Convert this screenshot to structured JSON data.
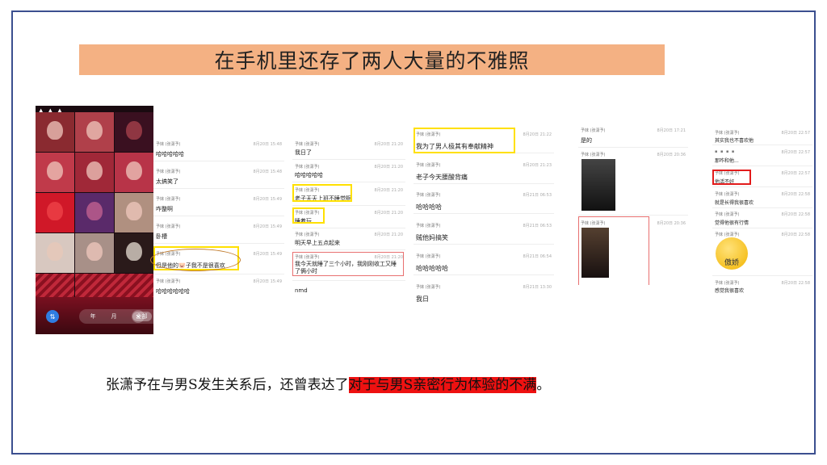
{
  "title": "在手机里还存了两人大量的不雅照",
  "caption": {
    "prefix": "张潇予在与男S发生关系后，还曾表达了",
    "highlight": "对于与男S亲密行为体验的不满",
    "suffix": "。"
  },
  "photo_grid": {
    "tabs": [
      "年",
      "月",
      "全部"
    ],
    "selected_tab": "全部",
    "left_icon": "sort-icon",
    "right_icon": "close-icon"
  },
  "panel1": {
    "messages": [
      {
        "sender": "予妹 (张潇予)",
        "time": "8月20日 15:48",
        "text": "哈哈哈哈哈"
      },
      {
        "sender": "予妹 (张潇予)",
        "time": "8月20日 15:48",
        "text": "太搞笑了"
      },
      {
        "sender": "予妹 (张潇予)",
        "time": "8月20日 15:49",
        "text": "咋整啊"
      },
      {
        "sender": "予妹 (张潇予)",
        "time": "8月20日 15:49",
        "text": "卧槽"
      },
      {
        "sender": "予妹 (张潇予)",
        "time": "8月20日 15:49",
        "text": "但是他的🐷子我不是很喜欢"
      },
      {
        "sender": "予妹 (张潇予)",
        "time": "8月20日 15:49",
        "text": "哈哈哈哈哈哈"
      }
    ]
  },
  "panel2": {
    "messages": [
      {
        "sender": "予妹 (张潇予)",
        "time": "8月20日 21:20",
        "text": "我日了"
      },
      {
        "sender": "予妹 (张潇予)",
        "time": "8月20日 21:20",
        "text": "哈哈哈哈哈"
      },
      {
        "sender": "予妹 (张潇予)",
        "time": "8月20日 21:20",
        "text": "老子天天上班不睡觉啊"
      },
      {
        "sender": "予妹 (张潇予)",
        "time": "8月20日 21:20",
        "text": "睡着玩"
      },
      {
        "sender": "予妹 (张潇予)",
        "time": "8月20日 21:20",
        "text": "明天早上五点起来"
      },
      {
        "sender": "予妹 (张潇予)",
        "time": "8月20日 21:20",
        "text": "我今天就睡了三个小时，我刚刚收工又睡了俩小时"
      },
      {
        "sender": "",
        "time": "",
        "text": "nmd"
      }
    ]
  },
  "panel3": {
    "messages": [
      {
        "sender": "予妹 (张潇予)",
        "time": "8月20日 21:22",
        "text": "我为了男人极其有奉献精神"
      },
      {
        "sender": "予妹 (张潇予)",
        "time": "8月20日 21:23",
        "text": "老子今天腰酸背痛"
      },
      {
        "sender": "予妹 (张潇予)",
        "time": "8月21日 06:53",
        "text": "哈哈哈哈"
      },
      {
        "sender": "予妹 (张潇予)",
        "time": "8月21日 06:53",
        "text": "贼他妈搞笑"
      },
      {
        "sender": "予妹 (张潇予)",
        "time": "8月21日 06:54",
        "text": "哈哈哈哈哈"
      },
      {
        "sender": "予妹 (张潇予)",
        "time": "8月21日 13:30",
        "text": "我日"
      }
    ]
  },
  "panel4": {
    "messages": [
      {
        "sender": "予妹 (张潇予)",
        "time": "8月20日 17:21",
        "text": "是的"
      },
      {
        "sender": "予妹 (张潇予)",
        "time": "8月20日 20:36",
        "text": ""
      },
      {
        "sender": "予妹 (张潇予)",
        "time": "8月20日 20:36",
        "text": ""
      }
    ]
  },
  "panel5": {
    "messages": [
      {
        "sender": "予妹 (张潇予)",
        "time": "8月20日 22:57",
        "text": "其实我也不喜欢他"
      },
      {
        "sender": "",
        "time": "8月20日 22:57",
        "text": "那咋和他..."
      },
      {
        "sender": "予妹 (张潇予)",
        "time": "8月20日 22:57",
        "text": "他活不好"
      },
      {
        "sender": "予妹 (张潇予)",
        "time": "8月20日 22:58",
        "text": "就是长得我很喜欢"
      },
      {
        "sender": "予妹 (张潇予)",
        "time": "8月20日 22:58",
        "text": "觉得他很有行情"
      },
      {
        "sender": "予妹 (张潇予)",
        "time": "8月20日 22:58",
        "text": "[傲娇]"
      },
      {
        "sender": "予妹 (张潇予)",
        "time": "8月20日 22:58",
        "text": "感觉我很喜欢"
      }
    ],
    "emoji_label": "傲娇"
  },
  "colors": {
    "title_bg": "#f4b183",
    "frame_border": "#3b4f8f",
    "highlight_yellow": "#ffe000",
    "highlight_red": "#e21b1b",
    "caption_highlight": "#ee1111"
  }
}
